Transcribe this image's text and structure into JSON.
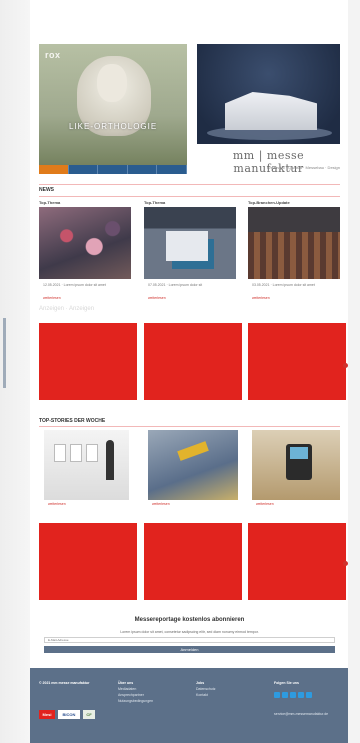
{
  "hero": {
    "left_logo": "rox",
    "left_tagline": "LIKE-ORTHOLOGIE",
    "brand": "mm | messe manufaktur",
    "brand_sub": "Kreativität · Qualität · Messebau · Design",
    "nav_items": [
      "",
      "",
      "",
      "",
      ""
    ]
  },
  "news": {
    "section_title": "NEWS",
    "cards": [
      {
        "label": "Top-Thema",
        "meta": "12.05.2021 · Lorem ipsum dolor sit amet",
        "link": "weiterlesen"
      },
      {
        "label": "Top-Thema",
        "meta": "07.05.2021 · Lorem ipsum dolor sit",
        "link": "weiterlesen"
      },
      {
        "label": "Top-Branchen-Update",
        "meta": "03.05.2021 · Lorem ipsum dolor sit amet",
        "link": "weiterlesen"
      }
    ],
    "faded_line": "Anzeigen · Anzeigen"
  },
  "featured": {
    "section_title": "TOP-STORIES DER WOCHE",
    "items": [
      {
        "caption": "weiterlesen"
      },
      {
        "caption": "weiterlesen"
      },
      {
        "caption": "weiterlesen"
      }
    ]
  },
  "newsletter": {
    "title": "Messereportage kostenlos abonnieren",
    "text": "Lorem ipsum dolor sit amet, consetetur sadipscing elitr, sed diam nonumy eirmod tempor.",
    "input_placeholder": "E-Mail-Adresse",
    "button": "Anmelden"
  },
  "footer": {
    "col1": {
      "head": "© 2021 mm messe manufaktur",
      "items": []
    },
    "col2": {
      "head": "Über uns",
      "items": [
        "Mediadaten",
        "Ansprechpartner",
        "Nutzungsbedingungen"
      ]
    },
    "col3": {
      "head": "Jobs",
      "items": [
        "Datenschutz",
        "Kontakt"
      ]
    },
    "col4": {
      "head": "Folgen Sie uns",
      "items": []
    },
    "contact": "service@mm-messemanufaktur.de",
    "logos": [
      "Mesi",
      "BICON",
      "CF"
    ]
  },
  "colors": {
    "accent": "#e1231e",
    "footer": "#5c7089",
    "link": "#d0332e"
  }
}
